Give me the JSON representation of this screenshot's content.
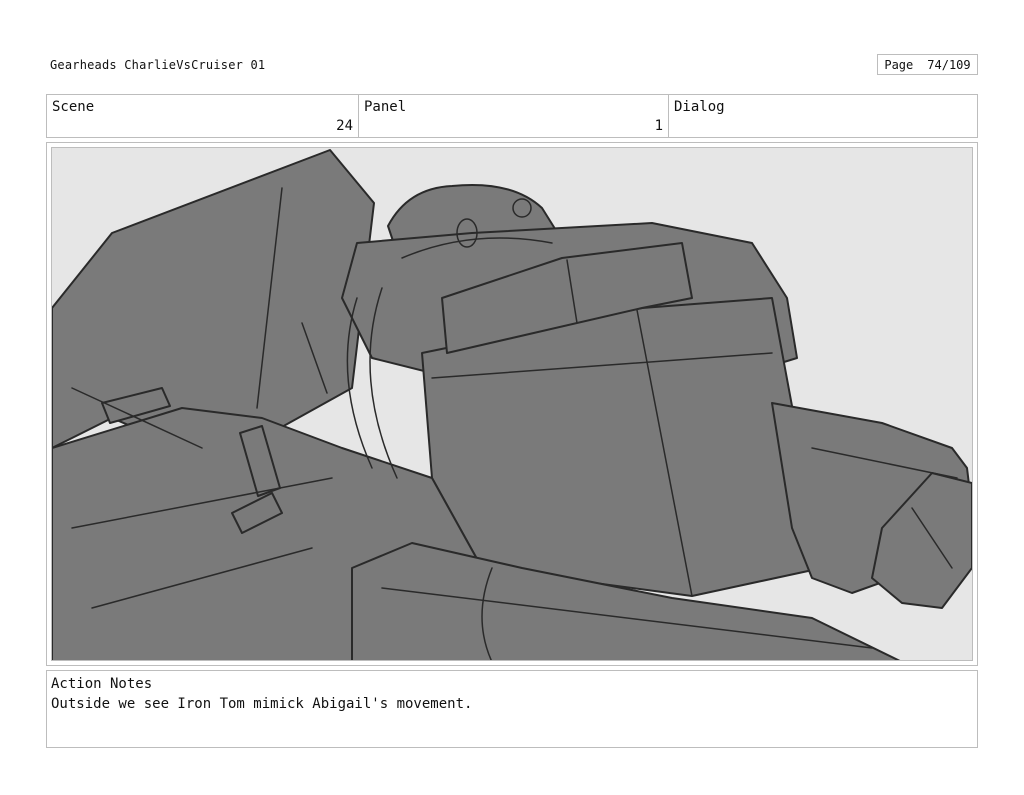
{
  "header": {
    "project_title": "Gearheads CharlieVsCruiser 01",
    "page_label": "Page",
    "page_number": "74/109"
  },
  "fields": {
    "scene_label": "Scene",
    "scene_value": "24",
    "panel_label": "Panel",
    "panel_value": "1",
    "dialog_label": "Dialog",
    "dialog_value": ""
  },
  "panel_image": {
    "subject": "sketch of giant robot (Iron Tom) reclining",
    "style": "grayscale pencil sketch",
    "colors": {
      "background": "#e6e6e6",
      "fill": "#7a7a7a",
      "line": "#2a2a2a"
    }
  },
  "notes": {
    "label": "Action Notes",
    "text": "Outside we see Iron Tom mimick Abigail's movement."
  }
}
